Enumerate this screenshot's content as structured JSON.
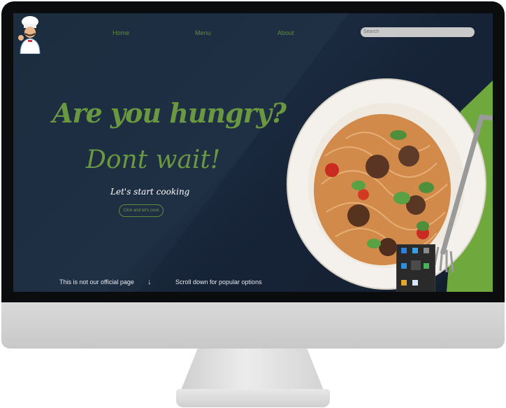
{
  "nav": {
    "items": [
      "Home",
      "Menu",
      "About"
    ]
  },
  "search": {
    "placeholder": "Search"
  },
  "hero": {
    "title": "Are you hungry?",
    "subtitle": "Dont wait!",
    "tagline": "Let's start cooking",
    "cta_label": "Click and let's cook"
  },
  "footer_strip": {
    "note": "This is not our official page",
    "arrow": "↓",
    "scroll_hint": "Scroll down for popular options"
  },
  "colors": {
    "accent_green": "#6a9841",
    "screen_bg": "#1d2d40",
    "search_bg": "#c9c9c9"
  },
  "icons": [
    "chef-logo-icon",
    "down-arrow-icon",
    "pasta-plate-image",
    "bluetooth-icon",
    "shield-icon",
    "monitor-icon",
    "app-icon",
    "pen-icon",
    "phone-icon",
    "folder-icon",
    "document-icon"
  ]
}
